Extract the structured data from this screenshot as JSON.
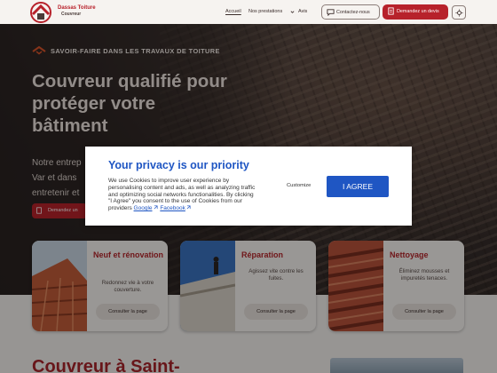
{
  "header": {
    "logo": {
      "name": "Dassas Toiture",
      "subtitle": "Couvreur"
    },
    "nav": {
      "home": "Accueil",
      "services": "Nos prestations",
      "reviews": "Avis"
    },
    "contact_label": "Contactez-nous",
    "quote_label": "Demandez un devis"
  },
  "hero": {
    "kicker": "SAVOIR-FAIRE DANS LES TRAVAUX DE TOITURE",
    "title": "Couvreur qualifié pour protéger votre bâtiment",
    "text": "Notre entrep Var et dans entretenir et",
    "cta_label": "Demandez un"
  },
  "cards": [
    {
      "title": "Neuf et rénovation",
      "desc": "Redonnez vie à votre couverture.",
      "button": "Consulter la page"
    },
    {
      "title": "Réparation",
      "desc": "Agissez vite contre les fuites.",
      "button": "Consulter la page"
    },
    {
      "title": "Nettoyage",
      "desc": "Éliminez mousses et impuretés tenaces.",
      "button": "Consulter la page"
    }
  ],
  "section": {
    "title": "Couvreur à Saint-"
  },
  "cookie": {
    "title": "Your privacy is our priority",
    "text": "We use Cookies to improve user experience by personalising content and ads, as well as analyzing traffic and optimizing social networks functionalities. By clicking \"I Agree\" you consent to the use of Cookies from our providers",
    "link_google": "Google",
    "link_facebook": "Facebook",
    "customize": "Customize",
    "agree": "I AGREE"
  },
  "colors": {
    "brand_red": "#b7222b",
    "dialog_blue": "#1f56c3"
  }
}
